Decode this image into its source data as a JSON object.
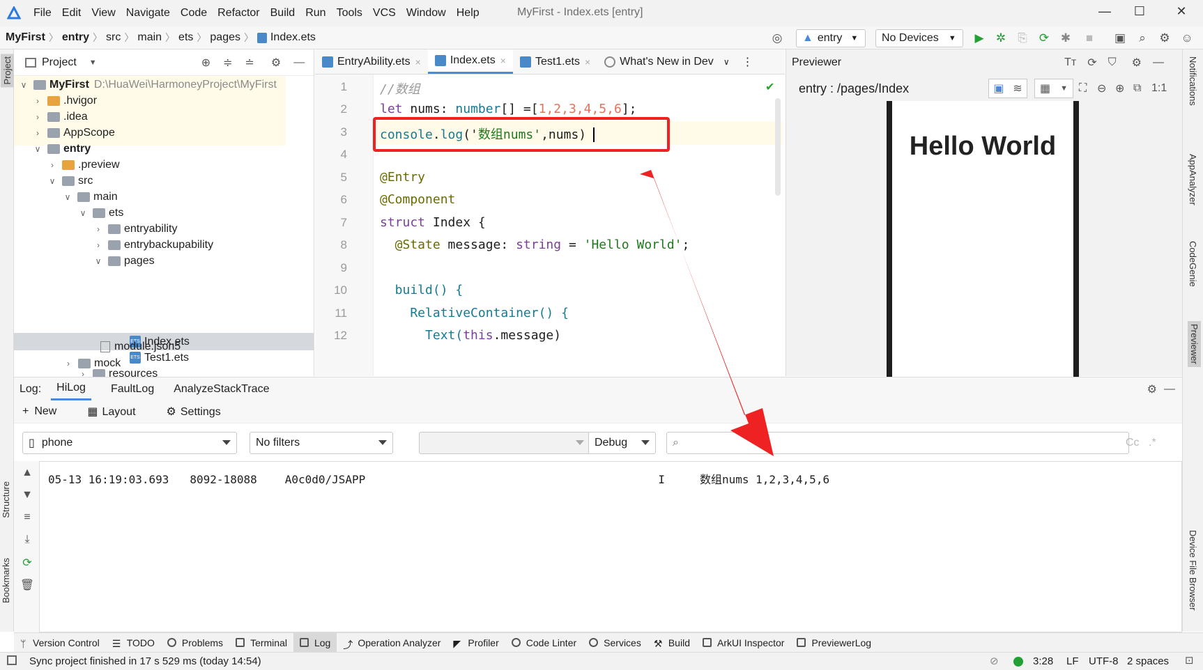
{
  "app": {
    "menu": [
      "File",
      "Edit",
      "View",
      "Navigate",
      "Code",
      "Refactor",
      "Build",
      "Run",
      "Tools",
      "VCS",
      "Window",
      "Help"
    ],
    "title": "MyFirst - Index.ets [entry]"
  },
  "nav": {
    "breadcrumbs": [
      "MyFirst",
      "entry",
      "src",
      "main",
      "ets",
      "pages",
      "Index.ets"
    ],
    "run_config": "entry",
    "device": "No Devices"
  },
  "project": {
    "header": "Project",
    "root_name": "MyFirst",
    "root_path": "D:\\HuaWei\\HarmoneyProject\\MyFirst",
    "items": [
      {
        "label": ".hvigor"
      },
      {
        "label": ".idea"
      },
      {
        "label": "AppScope"
      },
      {
        "label": "entry"
      },
      {
        "label": ".preview"
      },
      {
        "label": "src"
      },
      {
        "label": "main"
      },
      {
        "label": "ets"
      },
      {
        "label": "entryability"
      },
      {
        "label": "entrybackupability"
      },
      {
        "label": "pages"
      },
      {
        "label": "Index.ets"
      },
      {
        "label": "Test1.ets"
      },
      {
        "label": "resources"
      },
      {
        "label": "module.json5"
      },
      {
        "label": "mock"
      }
    ],
    "ets_badge": "ETS"
  },
  "editor": {
    "tabs": [
      "EntryAbility.ets",
      "Index.ets",
      "Test1.ets",
      "What's New in Dev"
    ],
    "active_tab": "Index.ets",
    "line_numbers": [
      "1",
      "2",
      "3",
      "4",
      "5",
      "6",
      "7",
      "8",
      "9",
      "10",
      "11",
      "12"
    ],
    "lines": {
      "l1": "//数组",
      "l2_a": "let",
      "l2_b": " nums",
      "l2_c": ": ",
      "l2_d": "number",
      "l2_e": "[] =[",
      "l2_f": "1,2,3,4,5,6",
      "l2_g": "];",
      "l3_a": "console",
      "l3_b": ".",
      "l3_c": "log",
      "l3_d": "('",
      "l3_e": "数组nums'",
      "l3_f": ",nums)",
      "l5": "@Entry",
      "l6": "@Component",
      "l7_a": "struct",
      "l7_b": " Index {",
      "l8_a": "  @State",
      "l8_b": " message: ",
      "l8_c": "string",
      "l8_d": " = ",
      "l8_e": "'Hello World'",
      "l8_f": ";",
      "l10": "  build() {",
      "l11": "    RelativeContainer() {",
      "l12_a": "      Text(",
      "l12_b": "this",
      "l12_c": ".message)"
    }
  },
  "previewer": {
    "title": "Previewer",
    "path": "entry : /pages/Index",
    "screen_text": "Hello World"
  },
  "log": {
    "label": "Log:",
    "tabs": [
      "HiLog",
      "FaultLog",
      "AnalyzeStackTrace"
    ],
    "tools": [
      "New",
      "Layout",
      "Settings"
    ],
    "device_filter": "phone",
    "filter": "No filters",
    "level": "Debug",
    "case_btn": "Cc",
    "entry": {
      "time": "05-13 16:19:03.693",
      "pid": "8092-18088",
      "tag": "A0c0d0/JSAPP",
      "level": "I",
      "message": "数组nums 1,2,3,4,5,6"
    }
  },
  "side_left": [
    "Project",
    "Structure",
    "Bookmarks"
  ],
  "side_right": [
    "Notifications",
    "AppAnalyzer",
    "CodeGenie",
    "Previewer",
    "Device File Browser"
  ],
  "toolwindows": [
    "Version Control",
    "TODO",
    "Problems",
    "Terminal",
    "Log",
    "Operation Analyzer",
    "Profiler",
    "Code Linter",
    "Services",
    "Build",
    "ArkUI Inspector",
    "PreviewerLog"
  ],
  "status": {
    "message": "Sync project finished in 17 s 529 ms (today 14:54)",
    "position": "3:28",
    "line_sep": "LF",
    "encoding": "UTF-8",
    "indent": "2 spaces"
  },
  "colors": {
    "accent": "#4a89dc",
    "highlight_box": "#ee2222",
    "run_green": "#22a033"
  }
}
